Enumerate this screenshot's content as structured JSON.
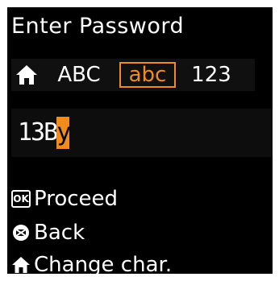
{
  "title": "Enter Password",
  "modes": [
    {
      "label": "ABC",
      "selected": false
    },
    {
      "label": "abc",
      "selected": true
    },
    {
      "label": "123",
      "selected": false
    }
  ],
  "input": {
    "text": "13B",
    "cursor_char": "y"
  },
  "actions": [
    {
      "badge": "OK",
      "label": "Proceed",
      "icon": "ok-badge-icon"
    },
    {
      "label": "Back",
      "icon": "stop-back-icon"
    },
    {
      "label": "Change char.",
      "icon": "home-icon"
    }
  ],
  "colors": {
    "accent": "#f08c1e",
    "background": "#000000",
    "text": "#ffffff"
  }
}
